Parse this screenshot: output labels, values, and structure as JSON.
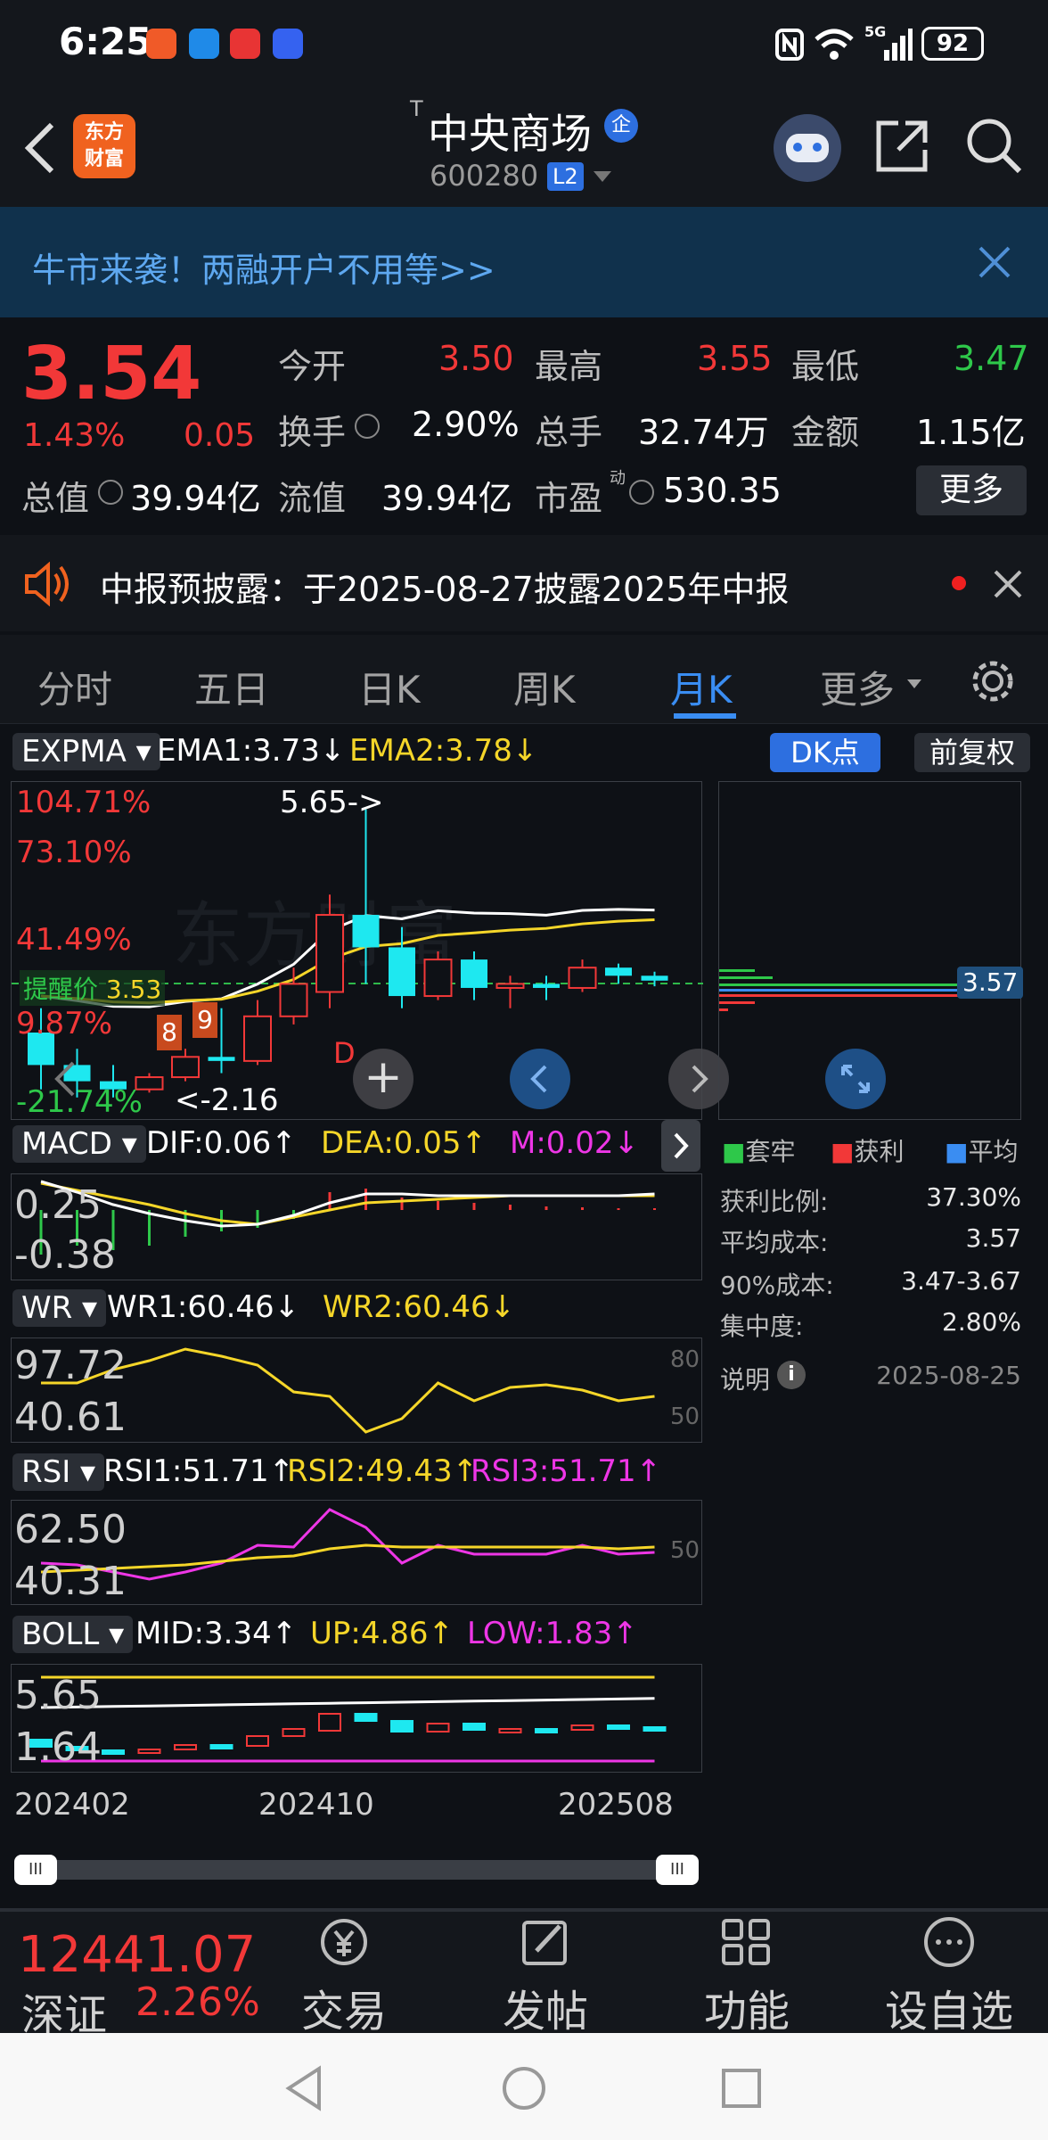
{
  "status_bar": {
    "time": "6:25",
    "battery": "92",
    "network": "5G"
  },
  "header": {
    "logo_text_line1": "东方",
    "logo_text_line2": "财富",
    "stock_name": "中央商场",
    "name_superscript": "T",
    "enterprise_badge": "企",
    "stock_code": "600280",
    "level_badge": "L2"
  },
  "banner": {
    "text": "牛市来袭！两融开户不用等>>"
  },
  "quote": {
    "price": "3.54",
    "change_pct": "1.43%",
    "change_val": "0.05",
    "open_label": "今开",
    "open": "3.50",
    "high_label": "最高",
    "high": "3.55",
    "low_label": "最低",
    "low": "3.47",
    "turnover_label": "换手",
    "turnover": "2.90%",
    "volume_label": "总手",
    "volume": "32.74万",
    "amount_label": "金额",
    "amount": "1.15亿",
    "mktcap_label": "总值",
    "mktcap": "39.94亿",
    "float_label": "流值",
    "float": "39.94亿",
    "pe_label": "市盈",
    "pe_sup": "动",
    "pe": "530.35",
    "more_button": "更多"
  },
  "notice": {
    "text": "中报预披露：于2025-08-27披露2025年中报"
  },
  "tabs": [
    "分时",
    "五日",
    "日K",
    "周K",
    "月K",
    "更多"
  ],
  "active_tab": "月K",
  "expma": {
    "name": "EXPMA",
    "ema1": "EMA1:3.73↓",
    "ema2": "EMA2:3.78↓",
    "dk_button": "DK点",
    "adjust_button": "前复权"
  },
  "kline": {
    "pct_labels": [
      "104.71%",
      "73.10%",
      "41.49%",
      "9.87%",
      "-21.74%"
    ],
    "high_mark": "5.65->",
    "low_mark": "<-2.16",
    "alert_label": "提醒价",
    "alert_value": "3.53",
    "d_mark": "D",
    "seq_mark_8": "8",
    "seq_mark_9": "9",
    "cost_label": "3.57",
    "candles": [
      {
        "o": 2.9,
        "c": 2.5,
        "h": 3.2,
        "l": 2.2
      },
      {
        "o": 2.5,
        "c": 2.3,
        "h": 2.7,
        "l": 2.1
      },
      {
        "o": 2.3,
        "c": 2.2,
        "h": 2.5,
        "l": 2.1
      },
      {
        "o": 2.2,
        "c": 2.35,
        "h": 2.4,
        "l": 2.16
      },
      {
        "o": 2.35,
        "c": 2.6,
        "h": 2.7,
        "l": 2.3
      },
      {
        "o": 2.6,
        "c": 2.55,
        "h": 3.2,
        "l": 2.4
      },
      {
        "o": 2.55,
        "c": 3.1,
        "h": 3.3,
        "l": 2.5
      },
      {
        "o": 3.1,
        "c": 3.5,
        "h": 3.7,
        "l": 3.0
      },
      {
        "o": 3.4,
        "c": 4.35,
        "h": 4.6,
        "l": 3.2
      },
      {
        "o": 4.35,
        "c": 3.95,
        "h": 5.65,
        "l": 3.5
      },
      {
        "o": 3.95,
        "c": 3.35,
        "h": 4.2,
        "l": 3.2
      },
      {
        "o": 3.35,
        "c": 3.8,
        "h": 3.9,
        "l": 3.3
      },
      {
        "o": 3.8,
        "c": 3.45,
        "h": 3.9,
        "l": 3.3
      },
      {
        "o": 3.45,
        "c": 3.5,
        "h": 3.6,
        "l": 3.2
      },
      {
        "o": 3.5,
        "c": 3.45,
        "h": 3.6,
        "l": 3.3
      },
      {
        "o": 3.45,
        "c": 3.7,
        "h": 3.8,
        "l": 3.4
      },
      {
        "o": 3.7,
        "c": 3.6,
        "h": 3.75,
        "l": 3.5
      },
      {
        "o": 3.6,
        "c": 3.54,
        "h": 3.65,
        "l": 3.47
      }
    ]
  },
  "chip": {
    "legend": [
      "套牢",
      "获利",
      "平均"
    ],
    "profit_ratio_label": "获利比例:",
    "profit_ratio": "37.30%",
    "avg_cost_label": "平均成本:",
    "avg_cost": "3.57",
    "cost90_label": "90%成本:",
    "cost90": "3.47-3.67",
    "concentration_label": "集中度:",
    "concentration": "2.80%",
    "note_label": "说明",
    "date": "2025-08-25"
  },
  "macd": {
    "name": "MACD",
    "dif": "DIF:0.06↑",
    "dea": "DEA:0.05↑",
    "m": "M:0.02↓",
    "top": "0.25",
    "bottom": "-0.38"
  },
  "wr": {
    "name": "WR",
    "wr1": "WR1:60.46↓",
    "wr2": "WR2:60.46↓",
    "top": "97.72",
    "bottom": "40.61",
    "ref1": "80",
    "ref2": "50"
  },
  "rsi": {
    "name": "RSI",
    "rsi1": "RSI1:51.71↑",
    "rsi2": "RSI2:49.43↑",
    "rsi3": "RSI3:51.71↑",
    "top": "62.50",
    "bottom": "40.31",
    "ref": "50"
  },
  "boll": {
    "name": "BOLL",
    "mid": "MID:3.34↑",
    "up": "UP:4.86↑",
    "low": "LOW:1.83↑",
    "top": "5.65",
    "bottom": "1.64"
  },
  "x_axis": [
    "202402",
    "202410",
    "202508"
  ],
  "index": {
    "value": "12441.07",
    "name": "深证",
    "change": "2.26%"
  },
  "bottom_nav": [
    "交易",
    "发帖",
    "功能",
    "设自选"
  ],
  "colors": {
    "up": "#f23838",
    "down": "#1ee8f0",
    "ema1": "#ffffff",
    "ema2": "#f5d629",
    "accent": "#3a8df2"
  }
}
